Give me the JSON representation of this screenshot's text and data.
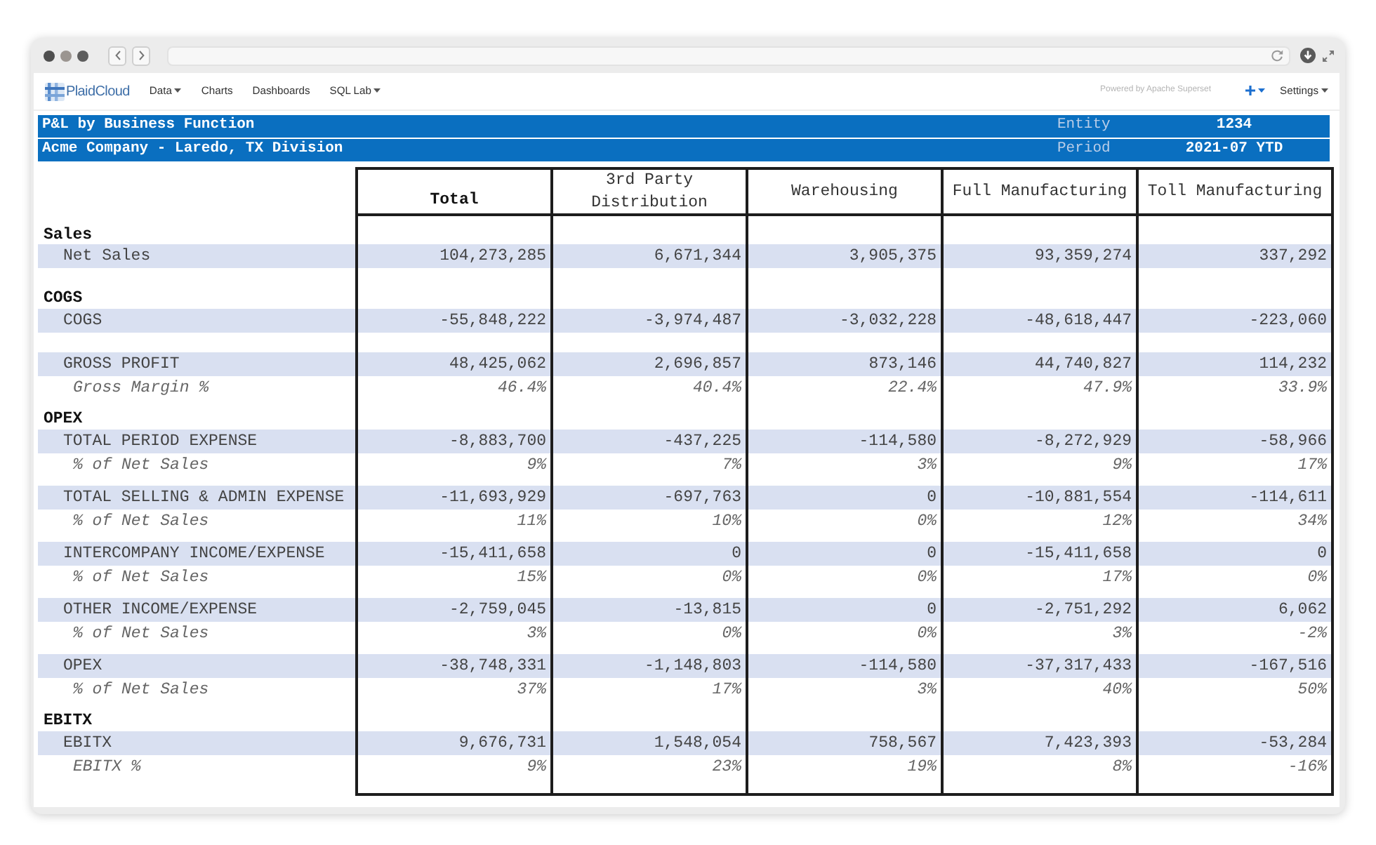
{
  "navbar": {
    "brand": "PlaidCloud",
    "items": [
      {
        "label": "Data",
        "dropdown": true
      },
      {
        "label": "Charts",
        "dropdown": false
      },
      {
        "label": "Dashboards",
        "dropdown": false
      },
      {
        "label": "SQL Lab",
        "dropdown": true
      }
    ],
    "powered_by": "Powered by Apache Superset",
    "add_menu": {
      "dropdown": true
    },
    "settings": {
      "label": "Settings",
      "dropdown": true
    }
  },
  "report_header": [
    {
      "title": "P&L by Business Function",
      "filter_label": "Entity",
      "filter_value": "1234"
    },
    {
      "title": "Acme Company - Laredo, TX Division",
      "filter_label": "Period",
      "filter_value": "2021-07 YTD"
    }
  ],
  "table": {
    "columns": [
      {
        "label": "Total",
        "kind": "total"
      },
      {
        "label": "3rd Party Distribution",
        "kind": "segment"
      },
      {
        "label": "Warehousing",
        "kind": "segment"
      },
      {
        "label": "Full Manufacturing",
        "kind": "segment"
      },
      {
        "label": "Toll Manufacturing",
        "kind": "segment"
      }
    ],
    "rows": [
      {
        "kind": "section",
        "label": "Sales"
      },
      {
        "kind": "item",
        "label": "Net Sales",
        "values": [
          "104,273,285",
          "6,671,344",
          "3,905,375",
          "93,359,274",
          "337,292"
        ]
      },
      {
        "kind": "spacer"
      },
      {
        "kind": "section",
        "label": "COGS"
      },
      {
        "kind": "item",
        "label": "COGS",
        "values": [
          "-55,848,222",
          "-3,974,487",
          "-3,032,228",
          "-48,618,447",
          "-223,060"
        ]
      },
      {
        "kind": "spacer"
      },
      {
        "kind": "item",
        "label": "GROSS PROFIT",
        "values": [
          "48,425,062",
          "2,696,857",
          "873,146",
          "44,740,827",
          "114,232"
        ]
      },
      {
        "kind": "ratio",
        "label": "Gross Margin %",
        "values": [
          "46.4%",
          "40.4%",
          "22.4%",
          "47.9%",
          "33.9%"
        ]
      },
      {
        "kind": "section",
        "label": "OPEX"
      },
      {
        "kind": "item",
        "label": "TOTAL PERIOD EXPENSE",
        "values": [
          "-8,883,700",
          "-437,225",
          "-114,580",
          "-8,272,929",
          "-58,966"
        ]
      },
      {
        "kind": "ratio",
        "label": "% of Net Sales",
        "values": [
          "9%",
          "7%",
          "3%",
          "9%",
          "17%"
        ]
      },
      {
        "kind": "item",
        "label": "TOTAL SELLING & ADMIN EXPENSE",
        "values": [
          "-11,693,929",
          "-697,763",
          "0",
          "-10,881,554",
          "-114,611"
        ]
      },
      {
        "kind": "ratio",
        "label": "% of Net Sales",
        "values": [
          "11%",
          "10%",
          "0%",
          "12%",
          "34%"
        ]
      },
      {
        "kind": "item",
        "label": "INTERCOMPANY INCOME/EXPENSE",
        "values": [
          "-15,411,658",
          "0",
          "0",
          "-15,411,658",
          "0"
        ]
      },
      {
        "kind": "ratio",
        "label": "% of Net Sales",
        "values": [
          "15%",
          "0%",
          "0%",
          "17%",
          "0%"
        ]
      },
      {
        "kind": "item",
        "label": "OTHER INCOME/EXPENSE",
        "values": [
          "-2,759,045",
          "-13,815",
          "0",
          "-2,751,292",
          "6,062"
        ]
      },
      {
        "kind": "ratio",
        "label": "% of Net Sales",
        "values": [
          "3%",
          "0%",
          "0%",
          "3%",
          "-2%"
        ]
      },
      {
        "kind": "item",
        "label": "OPEX",
        "values": [
          "-38,748,331",
          "-1,148,803",
          "-114,580",
          "-37,317,433",
          "-167,516"
        ]
      },
      {
        "kind": "ratio",
        "label": "% of Net Sales",
        "values": [
          "37%",
          "17%",
          "3%",
          "40%",
          "50%"
        ]
      },
      {
        "kind": "section",
        "label": "EBITX"
      },
      {
        "kind": "item",
        "label": "EBITX",
        "values": [
          "9,676,731",
          "1,548,054",
          "758,567",
          "7,423,393",
          "-53,284"
        ]
      },
      {
        "kind": "ratio",
        "label": "EBITX %",
        "values": [
          "9%",
          "23%",
          "19%",
          "8%",
          "-16%"
        ]
      }
    ]
  }
}
